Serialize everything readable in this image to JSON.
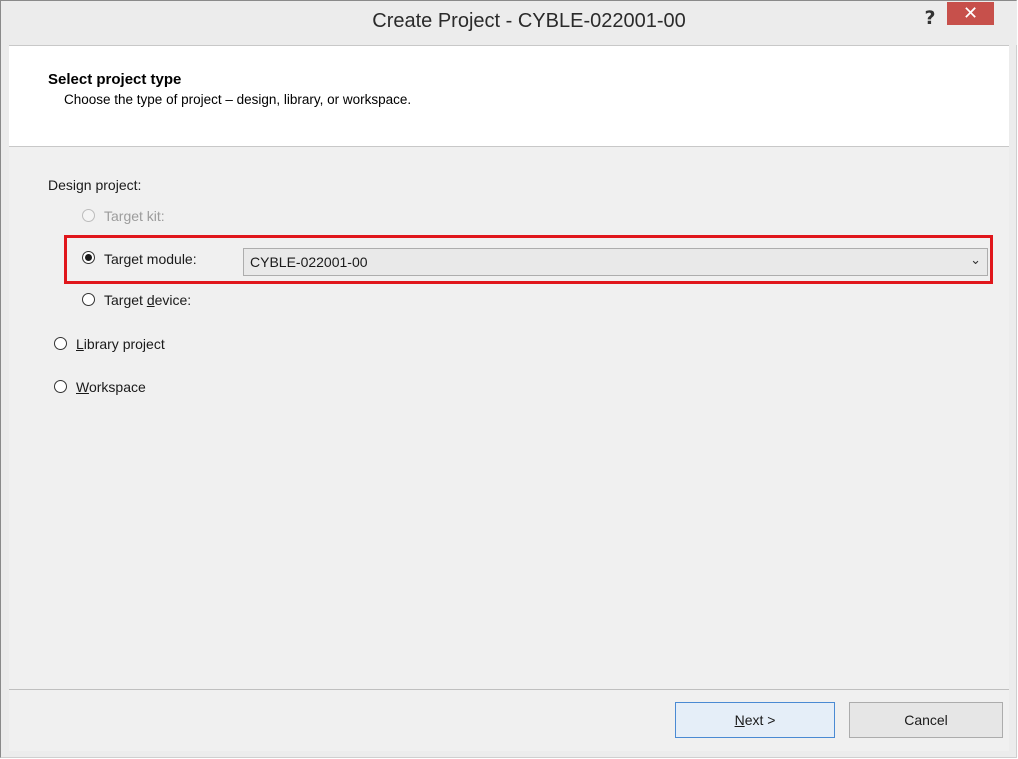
{
  "window": {
    "title": "Create Project - CYBLE-022001-00",
    "help_label": "?",
    "close_label": "✕"
  },
  "header": {
    "title": "Select project type",
    "subtitle": "Choose the type of project – design, library, or workspace."
  },
  "content": {
    "design_label": "Design project:",
    "options": {
      "target_kit": {
        "label": "Target kit:",
        "enabled": false,
        "selected": false
      },
      "target_module": {
        "label": "Target module:",
        "enabled": true,
        "selected": true
      },
      "target_device": {
        "pre": "Target ",
        "mnemonic": "d",
        "post": "evice:",
        "enabled": true,
        "selected": false
      },
      "library_project": {
        "mnemonic": "L",
        "post": "ibrary project",
        "selected": false
      },
      "workspace": {
        "mnemonic": "W",
        "post": "orkspace",
        "selected": false
      }
    },
    "module_select": {
      "value": "CYBLE-022001-00"
    }
  },
  "footer": {
    "next": {
      "mnemonic": "N",
      "post": "ext >"
    },
    "cancel": "Cancel"
  },
  "colors": {
    "highlight": "#e0161b",
    "close_button": "#c7504b",
    "primary_button_border": "#4a8ad3"
  }
}
